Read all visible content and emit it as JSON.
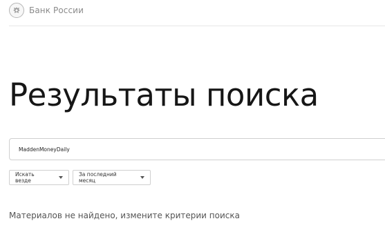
{
  "header": {
    "logo_text": "Банк России"
  },
  "page_title": "Результаты поиска",
  "search": {
    "value": "MaddenMoneyDaily"
  },
  "filters": {
    "where": "Искать везде",
    "period": "За последний месяц"
  },
  "no_results_text": "Материалов не найдено, измените критерии поиска"
}
